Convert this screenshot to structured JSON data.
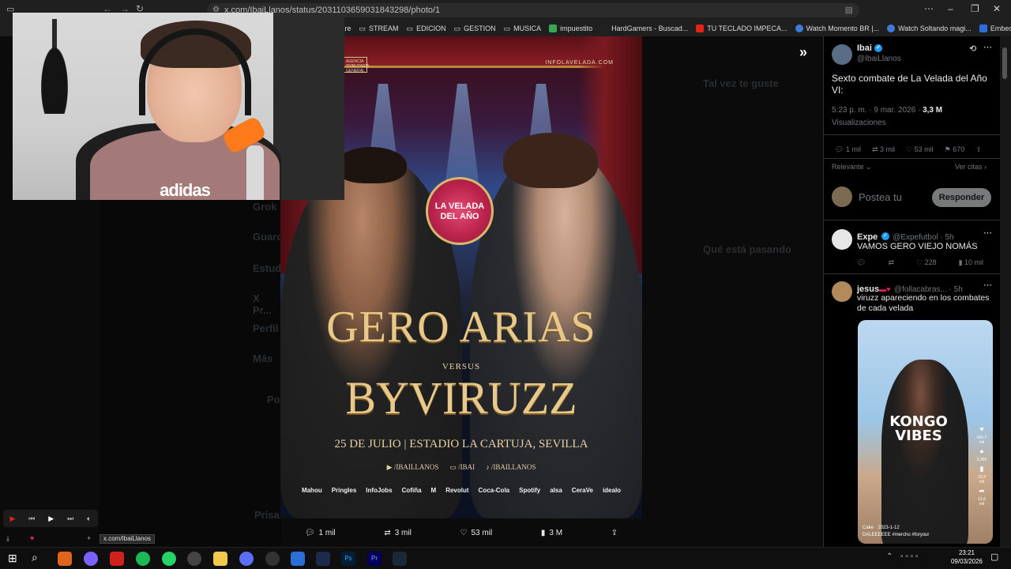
{
  "browser": {
    "url": "x.com/IbaiLlanos/status/2031103659031843298/photo/1",
    "bookmarks": [
      "ftware",
      "STREAM",
      "EDICION",
      "GESTION",
      "MUSICA",
      "impuestito",
      "HardGamers - Buscad...",
      "TU TECLADO IMPECA...",
      "Watch Momento BR |...",
      "Watch Soltando magi...",
      "Embed Generator"
    ]
  },
  "poster": {
    "brand": "INFOLAVELADA.COM",
    "agency": "AGENCIA TRIBUTARIA GENERAL",
    "badge": "LA VELADA DEL AÑO",
    "fighter1": "GERO ARIAS",
    "versus": "VERSUS",
    "fighter2": "BYVIRUZZ",
    "date_venue": "25 DE JULIO | ESTADIO LA CARTUJA, SEVILLA",
    "socials": [
      "/IBAILLANOS",
      "/IBAI",
      "/IBAILLANOS"
    ],
    "sponsors": [
      "Mahou",
      "Pringles",
      "InfoJobs",
      "Cofiña",
      "M",
      "Revolut",
      "Coca-Cola",
      "Spotify",
      "alsa",
      "CeraVe",
      "idealo"
    ]
  },
  "media_bar": {
    "replies": "1 mil",
    "reposts": "3 mil",
    "likes": "53 mil",
    "views": "3 M"
  },
  "tweet": {
    "author_name": "Ibai",
    "author_handle": "@IbaiLlanos",
    "text": "Sexto combate de La Velada del Año VI:",
    "time": "5:23 p. m. · 9 mar. 2026 ·",
    "views_count": "3,3 M",
    "views_label": "Visualizaciones",
    "replies": "1 mil",
    "reposts": "3 mil",
    "likes": "53 mil",
    "bookmarks": "670",
    "sort": "Relevante",
    "quotes": "Ver citas",
    "reply_placeholder": "Postea tu",
    "reply_button": "Responder"
  },
  "replies": [
    {
      "name": "Expe",
      "handle": "@Expefutbol · 5h",
      "text": "VAMOS GERO VIEJO NOMÁS",
      "likes": "228",
      "views": "10 mil"
    },
    {
      "name": "jesus",
      "handle": "@follacabras... · 5h",
      "text": "viruzz apareciendo en los combates de cada velada",
      "video_shirt": "KONGO VIBES",
      "video_caption_user": "Cake",
      "video_caption_date": "2023-1-12",
      "video_caption_text": "DALEEEEEE #mercho #foryour",
      "video_counts": [
        "542.7 mil",
        "3.360",
        "23,4 mil",
        "12,6 mil"
      ]
    }
  ],
  "dim_background": {
    "left_nav": [
      "Grok",
      "Guardados",
      "Estudio",
      "X Pr...",
      "Perfil",
      "Más",
      "Postear",
      "Prisa"
    ],
    "right_side": [
      "Tal vez te guste",
      "Qué está pasando"
    ]
  },
  "status_url": "x.com/IbaiLlanos",
  "clock": {
    "time": "23:21",
    "date": "09/03/2026"
  },
  "colors": {
    "accent": "#1d9bf0",
    "panel_bg": "#000000",
    "muted": "#71767b"
  }
}
